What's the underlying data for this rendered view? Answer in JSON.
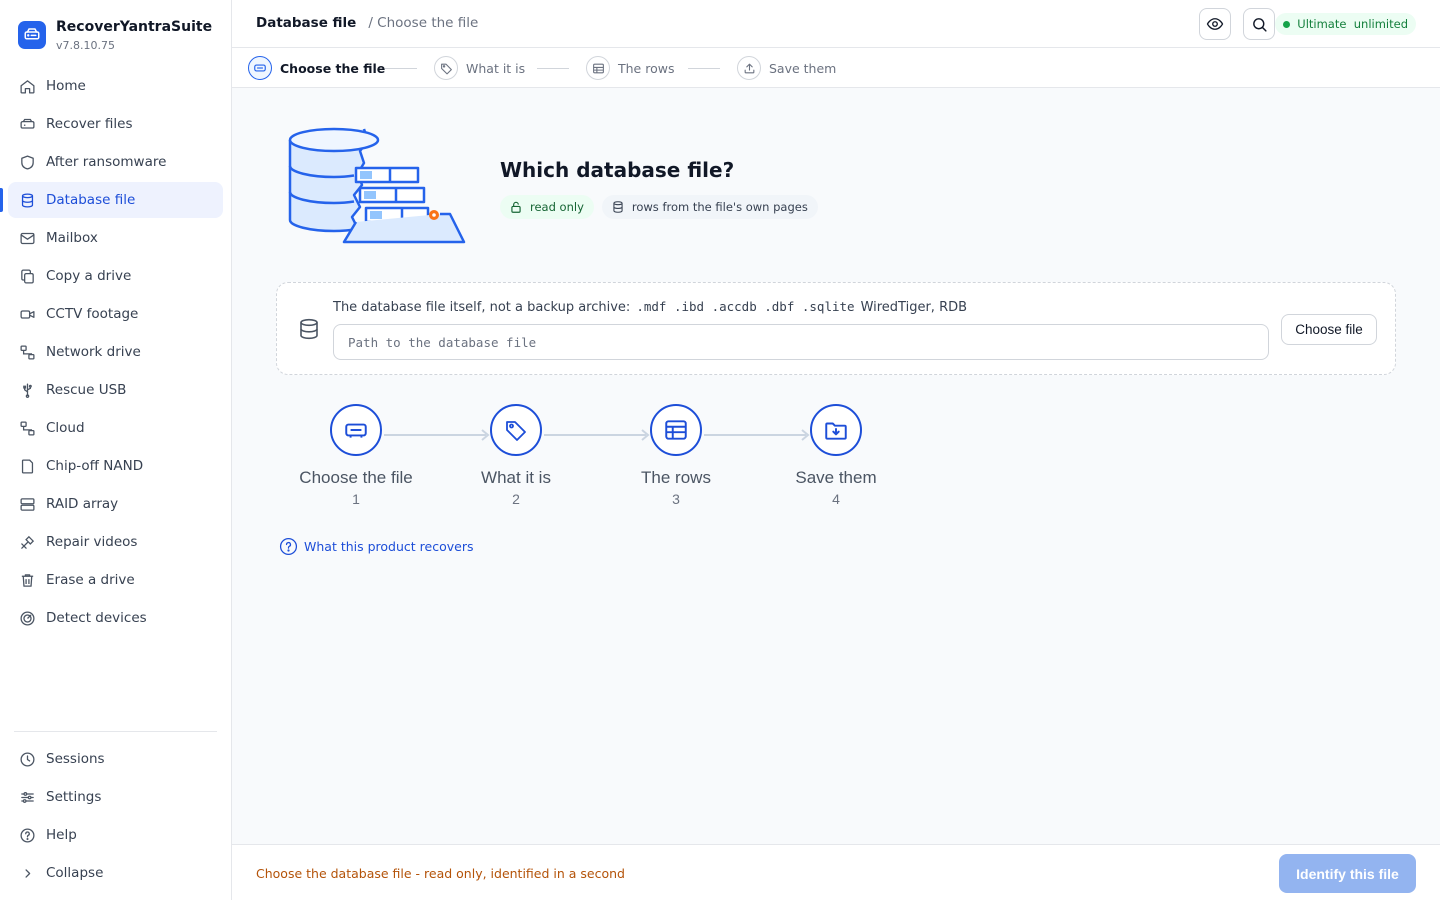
{
  "app": {
    "name": "RecoverYantraSuite",
    "version": "v7.8.10.75"
  },
  "sidebar": {
    "items": [
      {
        "label": "Home",
        "icon": "home-icon"
      },
      {
        "label": "Recover files",
        "icon": "drive-icon"
      },
      {
        "label": "After ransomware",
        "icon": "shield-icon"
      },
      {
        "label": "Database file",
        "icon": "database-icon",
        "active": true
      },
      {
        "label": "Mailbox",
        "icon": "mail-icon"
      },
      {
        "label": "Copy a drive",
        "icon": "copy-icon"
      },
      {
        "label": "CCTV footage",
        "icon": "camera-icon"
      },
      {
        "label": "Network drive",
        "icon": "network-icon"
      },
      {
        "label": "Rescue USB",
        "icon": "usb-icon"
      },
      {
        "label": "Cloud",
        "icon": "cloud-icon"
      },
      {
        "label": "Chip-off NAND",
        "icon": "chip-icon"
      },
      {
        "label": "RAID array",
        "icon": "raid-icon"
      },
      {
        "label": "Repair videos",
        "icon": "wrench-icon"
      },
      {
        "label": "Erase a drive",
        "icon": "trash-icon"
      },
      {
        "label": "Detect devices",
        "icon": "radar-icon"
      }
    ],
    "bottom_items": [
      {
        "label": "Sessions",
        "icon": "clock-icon"
      },
      {
        "label": "Settings",
        "icon": "sliders-icon"
      },
      {
        "label": "Help",
        "icon": "help-icon"
      },
      {
        "label": "Collapse",
        "icon": "chevron-right-icon"
      }
    ]
  },
  "header": {
    "breadcrumb_main": "Database file",
    "breadcrumb_sub": "/ Choose the file",
    "plan_badge": "Ultimate  unlimited"
  },
  "stepper": [
    {
      "label": "Choose the file",
      "active": true
    },
    {
      "label": "What it is"
    },
    {
      "label": "The rows"
    },
    {
      "label": "Save them"
    }
  ],
  "main": {
    "title": "Which database file?",
    "pill_readonly": "read only",
    "pill_rows": "rows from the file's own pages",
    "dropzone_desc": "The database file itself, not a backup archive:",
    "dropzone_exts": ".mdf .ibd .accdb .dbf .sqlite",
    "dropzone_tail": "WiredTiger, RDB",
    "path_placeholder": "Path to the database file",
    "path_value": "",
    "choose_button": "Choose file",
    "flow": [
      {
        "label": "Choose the file",
        "num": "1"
      },
      {
        "label": "What it is",
        "num": "2"
      },
      {
        "label": "The rows",
        "num": "3"
      },
      {
        "label": "Save them",
        "num": "4"
      }
    ],
    "help_link": "What this product recovers"
  },
  "footer": {
    "status": "Choose the database file - read only, identified in a second",
    "primary_button": "Identify this file"
  },
  "colors": {
    "accent": "#2563eb",
    "success": "#16a34a",
    "warning": "#b45309",
    "primary_disabled": "#93b4f0"
  }
}
